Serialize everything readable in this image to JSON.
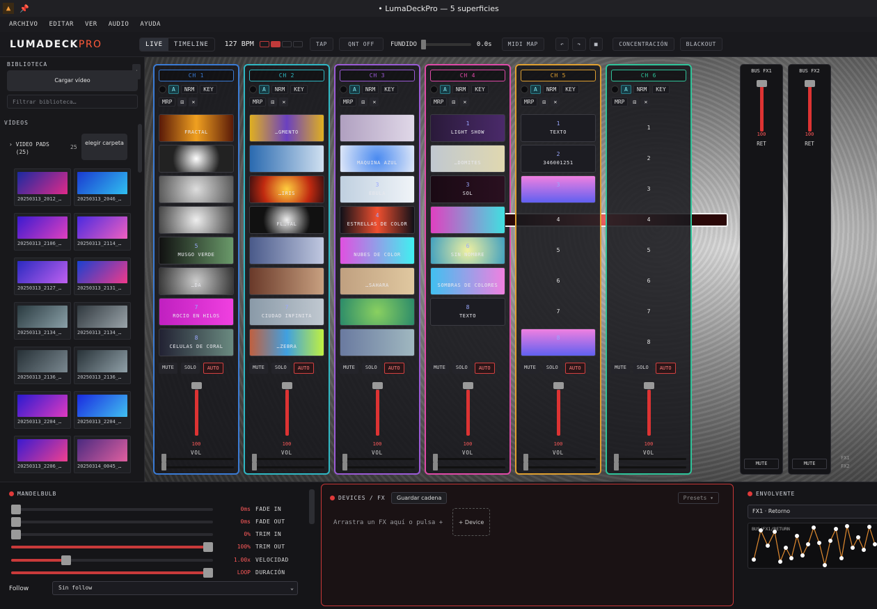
{
  "window": {
    "title": "• LumaDeckPro — 5 superficies"
  },
  "menu": [
    "ARCHIVO",
    "EDITAR",
    "VER",
    "AUDIO",
    "AYUDA"
  ],
  "toolbar": {
    "logo_main": "LUMADECK",
    "logo_accent": "PRO",
    "mode_live": "LIVE",
    "mode_timeline": "TIMELINE",
    "bpm_value": "127",
    "bpm_label": "BPM",
    "tap": "TAP",
    "quant": "QNT OFF",
    "fundido": "FUNDIDO",
    "fade_value": "0.0s",
    "midi_map": "MIDI MAP",
    "undo": "↶",
    "redo": "↷",
    "stop": "■",
    "concentracion": "CONCENTRACIÓN",
    "blackout": "BLACKOUT"
  },
  "sidebar": {
    "biblioteca": "BIBLIOTECA",
    "cargar": "Cargar vídeo",
    "filtro_placeholder": "Filtrar biblioteca…",
    "videos": "VÍDEOS",
    "pads_title": "VIDEO PADS",
    "pads_count_label": "(25)",
    "pads_count": "25",
    "elegir": "elegir carpeta",
    "thumbs": [
      "20250313_2012_…",
      "20250313_2046_…",
      "20250313_2106_…",
      "20250313_2114_…",
      "20250313_2127_…",
      "20250313_2131_…",
      "20250313_2134_…",
      "20250313_2134_…",
      "20250313_2136_…",
      "20250313_2136_…",
      "20250313_2204_…",
      "20250313_2204_…",
      "20250313_2206_…",
      "20250314_0045_…"
    ]
  },
  "channels": [
    {
      "name": "CH 1",
      "color": "#3a7bd5",
      "pads": [
        {
          "n": "",
          "l": "FRACTAL"
        },
        {
          "n": "",
          "l": ""
        },
        {
          "n": "",
          "l": ""
        },
        {
          "n": "",
          "l": ""
        },
        {
          "n": "5",
          "l": "MUSGO VERDE"
        },
        {
          "n": "",
          "l": "…DA"
        },
        {
          "n": "7",
          "l": "ROCÍO EN HILOS"
        },
        {
          "n": "8",
          "l": "CÉLULAS DE CORAL"
        }
      ],
      "vol": "100"
    },
    {
      "name": "CH 2",
      "color": "#2fb8c4",
      "pads": [
        {
          "n": "",
          "l": "…GMENTO"
        },
        {
          "n": "",
          "l": ""
        },
        {
          "n": "",
          "l": "…IRIS"
        },
        {
          "n": "",
          "l": "FL…TAL"
        },
        {
          "n": "",
          "l": ""
        },
        {
          "n": "",
          "l": ""
        },
        {
          "n": "7",
          "l": "CIUDAD INFINITA"
        },
        {
          "n": "",
          "l": "…ZEBRA"
        }
      ],
      "vol": "100"
    },
    {
      "name": "CH 3",
      "color": "#9b5bd6",
      "pads": [
        {
          "n": "",
          "l": ""
        },
        {
          "n": "",
          "l": "MAQUINA AZUL"
        },
        {
          "n": "3",
          "l": "EBULA"
        },
        {
          "n": "4",
          "l": "ESTRELLAS DE COLOR"
        },
        {
          "n": "",
          "l": "NUBES DE COLOR"
        },
        {
          "n": "",
          "l": "…SAHARA"
        },
        {
          "n": "",
          "l": ""
        },
        {
          "n": "",
          "l": ""
        }
      ],
      "vol": "100"
    },
    {
      "name": "CH 4",
      "color": "#e04aa8",
      "pads": [
        {
          "n": "1",
          "l": "LIGHT SHOW"
        },
        {
          "n": "",
          "l": "…DOMITES"
        },
        {
          "n": "3",
          "l": "SOL"
        },
        {
          "n": "",
          "l": ""
        },
        {
          "n": "",
          "l": ""
        },
        {
          "n": "6",
          "l": "SIN NOMBRE"
        },
        {
          "n": "",
          "l": "SOMBRAS DE COLORES"
        },
        {
          "n": "8",
          "l": "TEXTO"
        }
      ],
      "vol": "100"
    },
    {
      "name": "CH 5",
      "color": "#e0a030",
      "pads": [
        {
          "n": "1",
          "l": "TEXTO"
        },
        {
          "n": "2",
          "l": "346001251"
        },
        {
          "n": "3",
          "l": ""
        },
        {
          "n": "4",
          "l": ""
        },
        {
          "n": "5",
          "l": ""
        },
        {
          "n": "6",
          "l": ""
        },
        {
          "n": "7",
          "l": ""
        },
        {
          "n": "8",
          "l": ""
        }
      ],
      "vol": "100"
    },
    {
      "name": "CH 6",
      "color": "#2fc49a",
      "pads": [
        {
          "n": "1",
          "l": ""
        },
        {
          "n": "2",
          "l": ""
        },
        {
          "n": "3",
          "l": ""
        },
        {
          "n": "4",
          "l": ""
        },
        {
          "n": "5",
          "l": ""
        },
        {
          "n": "6",
          "l": ""
        },
        {
          "n": "7",
          "l": ""
        },
        {
          "n": "8",
          "l": ""
        }
      ],
      "vol": "100"
    }
  ],
  "channel_controls": {
    "mute": "MUTE",
    "solo": "SOLO",
    "auto": "AUTO",
    "vol": "VOL",
    "a": "A",
    "nrm": "NRM",
    "key": "KEY",
    "mrp": "MRP"
  },
  "buses": [
    {
      "name": "BUS FX1",
      "vol": "100",
      "ret": "RET",
      "mute": "MUTE"
    },
    {
      "name": "BUS FX2",
      "vol": "100",
      "ret": "RET",
      "mute": "MUTE"
    }
  ],
  "fx_labels": [
    "FX1",
    "FX2"
  ],
  "mandelbulb": {
    "title": "MANDELBULB",
    "params": [
      {
        "name": "FADE IN",
        "value": "0ms",
        "level": 0
      },
      {
        "name": "FADE OUT",
        "value": "0ms",
        "level": 0
      },
      {
        "name": "TRIM IN",
        "value": "0%",
        "level": 0
      },
      {
        "name": "TRIM OUT",
        "value": "100%",
        "level": 1
      },
      {
        "name": "VELOCIDAD",
        "value": "1.00x",
        "level": 0.26
      },
      {
        "name": "DURACIÓN",
        "value": "LOOP",
        "level": 1
      }
    ],
    "follow_label": "Follow",
    "follow_value": "Sin follow"
  },
  "devices": {
    "title": "DEVICES / FX",
    "guardar": "Guardar cadena",
    "presets": "Presets ▾",
    "drop": "Arrastra un FX aquí o pulsa +",
    "add": "+ Device"
  },
  "envolvente": {
    "title": "ENVOLVENTE",
    "select": "FX1 · Retorno",
    "graph_label": "BUS/FX1/RETURN"
  }
}
